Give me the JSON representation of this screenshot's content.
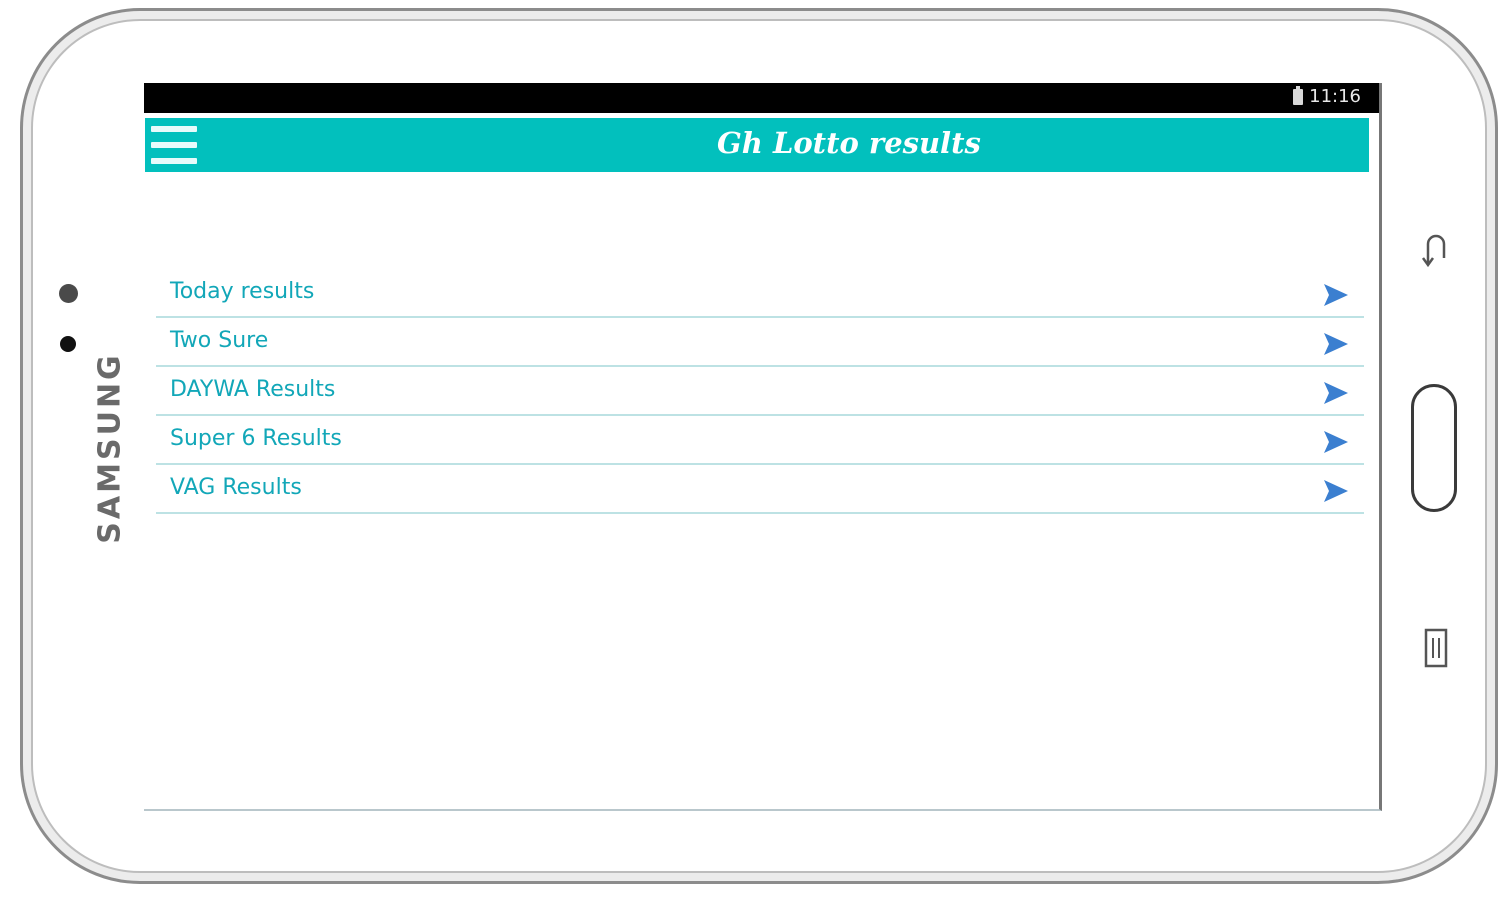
{
  "device": {
    "brand": "SAMSUNG"
  },
  "status_bar": {
    "time": "11:16",
    "battery_icon": "battery-icon"
  },
  "app_bar": {
    "menu_icon": "hamburger-menu-icon",
    "title": "Gh Lotto results",
    "color": "#02c0bd"
  },
  "menu": {
    "items": [
      {
        "label": "Today results",
        "icon": "send-arrow-icon"
      },
      {
        "label": "Two Sure",
        "icon": "send-arrow-icon"
      },
      {
        "label": "DAYWA Results",
        "icon": "send-arrow-icon"
      },
      {
        "label": "Super 6 Results",
        "icon": "send-arrow-icon"
      },
      {
        "label": "VAG Results",
        "icon": "send-arrow-icon"
      }
    ],
    "label_color": "#12a7b8",
    "arrow_color": "#3b7fd0"
  }
}
